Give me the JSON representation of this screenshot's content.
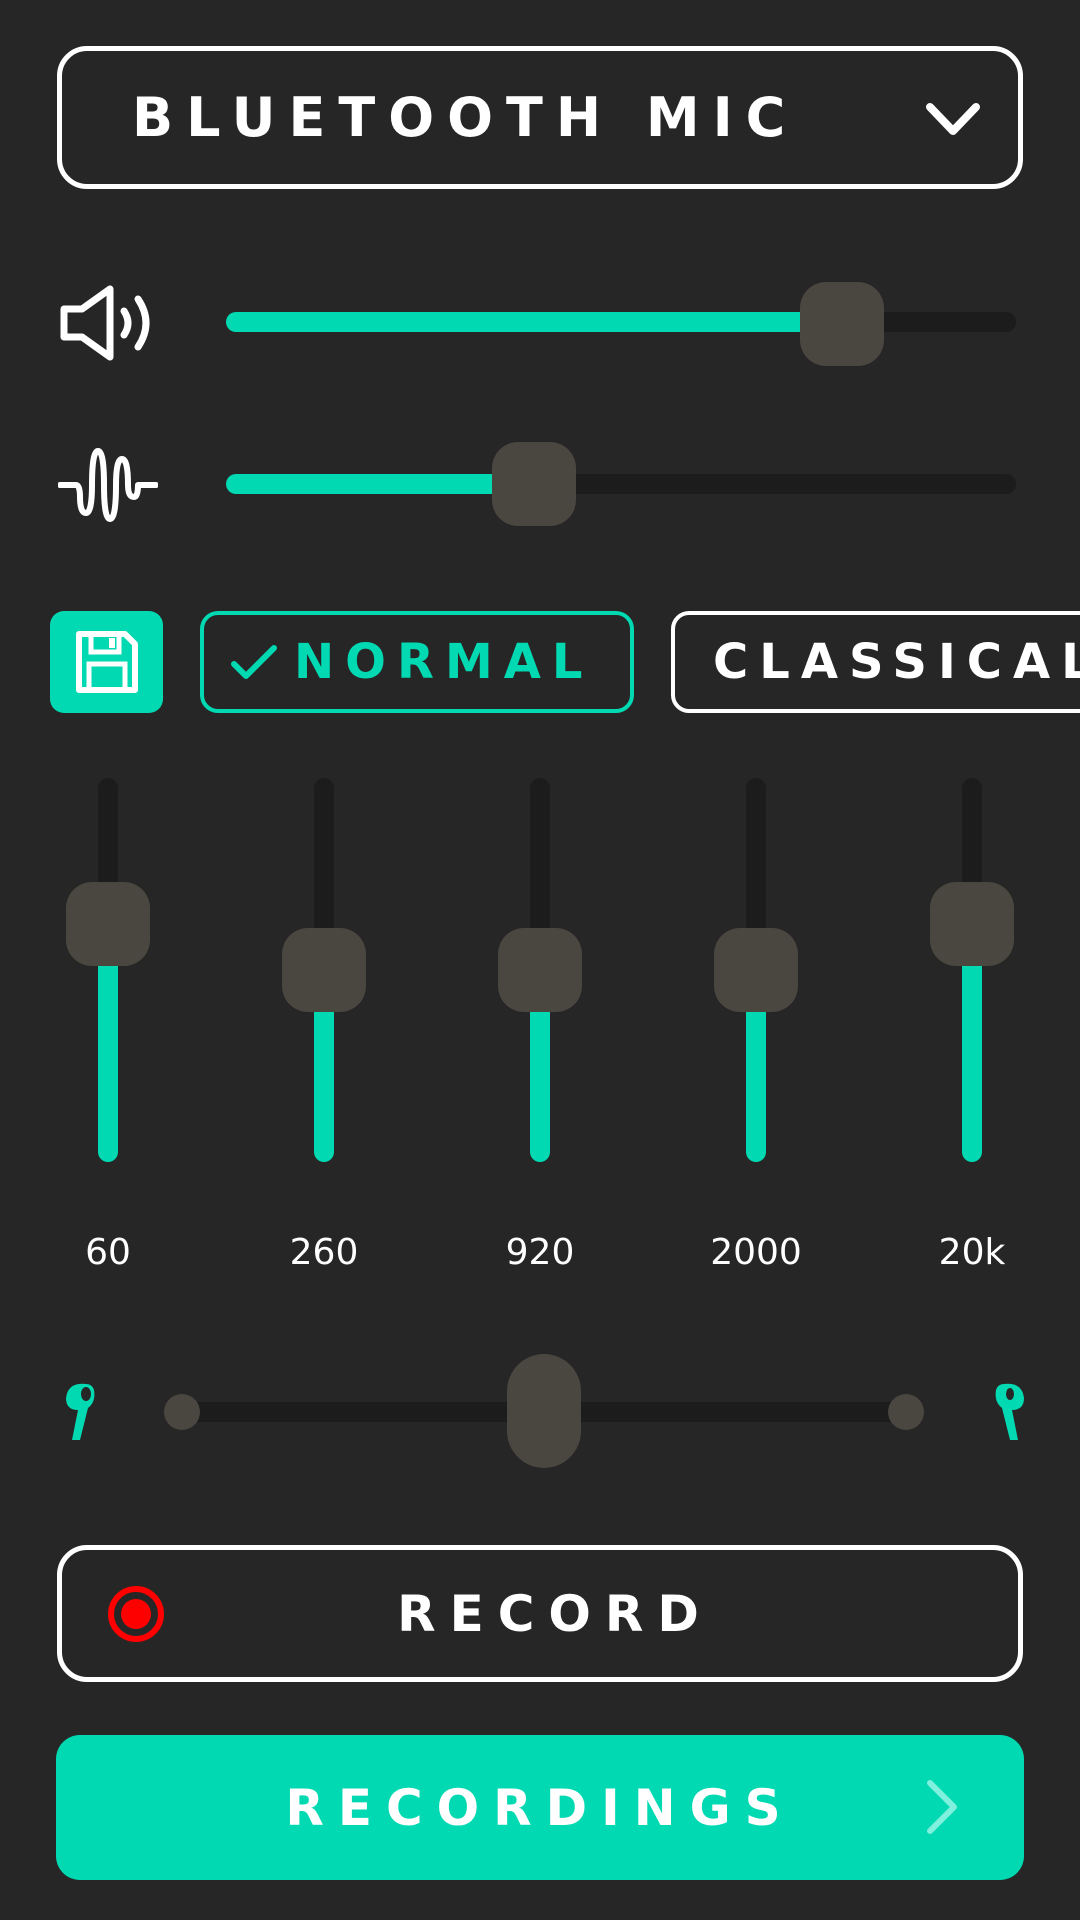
{
  "device": {
    "selected": "BLUETOOTH MIC",
    "icon": "chevron-down-icon"
  },
  "volume": {
    "icon": "speaker-icon",
    "value_fraction": 0.78
  },
  "gain": {
    "icon": "waveform-icon",
    "value_fraction": 0.39
  },
  "presets": {
    "save_icon": "floppy-disk-icon",
    "items": [
      {
        "label": "NORMAL",
        "selected": true,
        "icon": "check-icon"
      },
      {
        "label": "CLASSICAL",
        "selected": false
      }
    ]
  },
  "equalizer": {
    "bands": [
      {
        "label": "60",
        "value_fraction": 0.62
      },
      {
        "label": "260",
        "value_fraction": 0.5
      },
      {
        "label": "920",
        "value_fraction": 0.5
      },
      {
        "label": "2000",
        "value_fraction": 0.5
      },
      {
        "label": "20k",
        "value_fraction": 0.62
      }
    ]
  },
  "balance": {
    "left_icon": "earbud-left-icon",
    "right_icon": "earbud-right-icon",
    "value_fraction": 0.5
  },
  "record": {
    "label": "RECORD",
    "icon": "record-icon"
  },
  "recordings": {
    "label": "RECORDINGS",
    "icon": "chevron-right-icon"
  },
  "colors": {
    "background": "#262626",
    "accent": "#00d9b1",
    "thumb": "#4a4640",
    "track": "#1c1c1c",
    "record_red": "#ff0000",
    "text": "#ffffff"
  }
}
